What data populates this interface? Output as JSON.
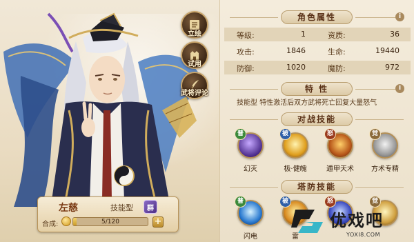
{
  "side_buttons": [
    {
      "label": "立绘",
      "icon": "scroll-icon"
    },
    {
      "label": "试用",
      "icon": "tower-icon"
    },
    {
      "label": "武将评论",
      "icon": "quill-icon"
    }
  ],
  "hero": {
    "name": "左慈",
    "type": "技能型",
    "faction": "群",
    "merge_label": "合成:",
    "merge_progress": "5/120",
    "merge_fraction": 0.042,
    "merge_add": "+"
  },
  "attributes": {
    "title": "角色属性",
    "info": "i",
    "rows": [
      {
        "l1": "等级:",
        "v1": "1",
        "l2": "资质:",
        "v2": "36"
      },
      {
        "l1": "攻击:",
        "v1": "1846",
        "l2": "生命:",
        "v2": "19440"
      },
      {
        "l1": "防御:",
        "v1": "1020",
        "l2": "魔防:",
        "v2": "972"
      }
    ]
  },
  "traits": {
    "title": "特 性",
    "info": "i",
    "text": "技能型 特性激活后双方武将死亡回复大量怒气"
  },
  "battle_skills": {
    "title": "对战技能",
    "items": [
      {
        "tag": "普",
        "name": "幻灭"
      },
      {
        "tag": "被",
        "name": "极·健魄"
      },
      {
        "tag": "怒",
        "name": "遁甲天术"
      },
      {
        "tag": "觉",
        "name": "方术专精"
      }
    ]
  },
  "tower_skills": {
    "title": "塔防技能",
    "items": [
      {
        "tag": "普",
        "name": "闪电"
      },
      {
        "tag": "被",
        "name": "雷"
      },
      {
        "tag": "怒",
        "name": ""
      },
      {
        "tag": "觉",
        "name": ""
      }
    ]
  },
  "watermark": {
    "name": "优戏吧",
    "url": "YOXI8.COM"
  }
}
